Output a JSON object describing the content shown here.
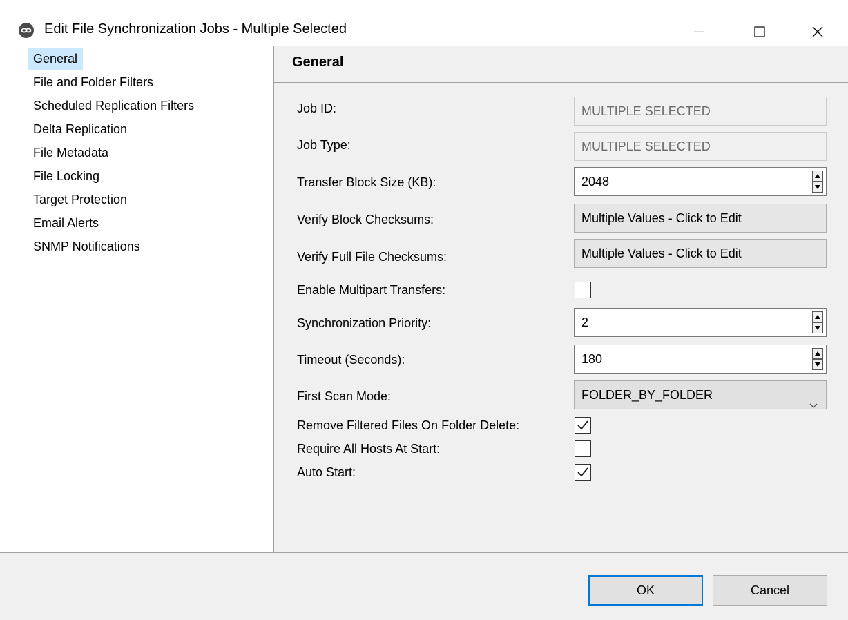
{
  "window": {
    "title": "Edit File Synchronization Jobs - Multiple Selected",
    "icons": [
      "app-icon",
      "minimize-icon",
      "maximize-icon",
      "close-icon"
    ]
  },
  "nav": {
    "items": [
      {
        "label": "General",
        "selected": true
      },
      {
        "label": "File and Folder Filters"
      },
      {
        "label": "Scheduled Replication Filters"
      },
      {
        "label": "Delta Replication"
      },
      {
        "label": "File Metadata"
      },
      {
        "label": "File Locking"
      },
      {
        "label": "Target Protection"
      },
      {
        "label": "Email Alerts"
      },
      {
        "label": "SNMP Notifications"
      }
    ]
  },
  "content": {
    "title": "General",
    "fields": {
      "job_id": {
        "label": "Job ID:",
        "value": "MULTIPLE SELECTED"
      },
      "job_type": {
        "label": "Job Type:",
        "value": "MULTIPLE SELECTED"
      },
      "transfer_block_size": {
        "label": "Transfer Block Size (KB):",
        "value": "2048"
      },
      "verify_block_checksums": {
        "label": "Verify Block Checksums:",
        "value": "Multiple Values - Click to Edit"
      },
      "verify_full_file_checksums": {
        "label": "Verify Full File Checksums:",
        "value": "Multiple Values - Click to Edit"
      },
      "enable_multipart_transfers": {
        "label": "Enable Multipart Transfers:",
        "checked": false
      },
      "synchronization_priority": {
        "label": "Synchronization Priority:",
        "value": "2"
      },
      "timeout_seconds": {
        "label": "Timeout (Seconds):",
        "value": "180"
      },
      "first_scan_mode": {
        "label": "First Scan Mode:",
        "value": "FOLDER_BY_FOLDER"
      },
      "remove_filtered_files": {
        "label": "Remove Filtered Files On Folder Delete:",
        "checked": true
      },
      "require_all_hosts": {
        "label": "Require All Hosts At Start:",
        "checked": false
      },
      "auto_start": {
        "label": "Auto Start:",
        "checked": true
      }
    }
  },
  "footer": {
    "ok_label": "OK",
    "cancel_label": "Cancel"
  },
  "colors": {
    "selection": "#cce8ff",
    "default_button_border": "#0078d7",
    "panel_background": "#f0f0f0"
  }
}
